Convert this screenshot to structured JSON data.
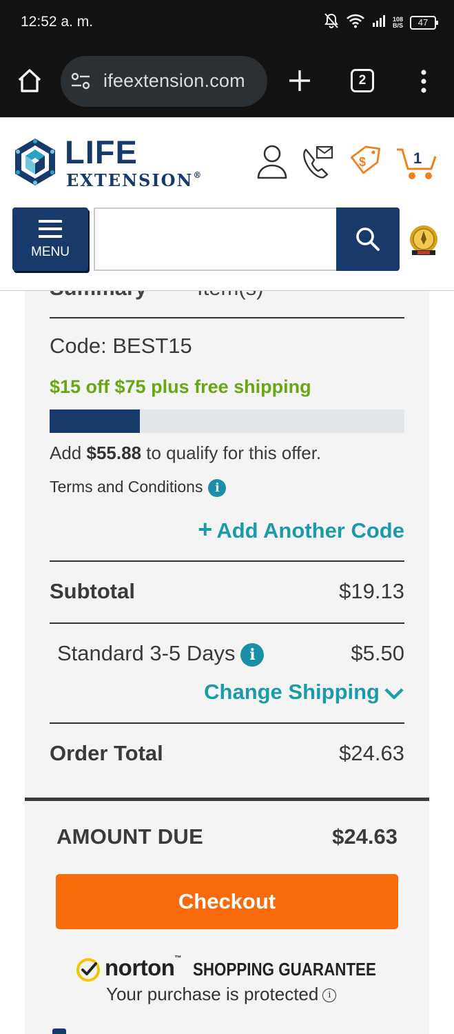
{
  "status_bar": {
    "time": "12:52 a. m.",
    "net_speed_value": "108",
    "net_speed_unit": "B/S",
    "battery": "47"
  },
  "browser": {
    "url": "ifeextension.com",
    "tab_count": "2"
  },
  "header": {
    "logo_line1": "LIFE",
    "logo_line2": "EXTENSION",
    "logo_registered": "®",
    "cart_count": "1",
    "menu_label": "MENU",
    "search_value": "",
    "accent_color": "#173a6b",
    "icons": [
      "account-icon",
      "contact-icon",
      "deals-icon",
      "cart-icon",
      "search-icon",
      "award-badge-icon"
    ]
  },
  "summary": {
    "cut_heading_left": "Summary",
    "cut_heading_right": "Item(s)",
    "code_line": "Code: BEST15",
    "promo_text": "$15 off $75 plus free shipping",
    "progress_fraction": 0.254,
    "qualify_prefix": "Add ",
    "qualify_amount": "$55.88",
    "qualify_suffix": " to qualify for this offer.",
    "terms_label": "Terms and Conditions",
    "add_code_label": "Add Another Code",
    "subtotal_label": "Subtotal",
    "subtotal_value": "$19.13",
    "shipping_label": "Standard 3-5 Days",
    "shipping_value": "$5.50",
    "change_shipping_label": "Change Shipping",
    "order_total_label": "Order Total",
    "order_total_value": "$24.63",
    "amount_due_label": "AMOUNT DUE",
    "amount_due_value": "$24.63",
    "checkout_label": "Checkout",
    "checkout_color": "#f96a0c",
    "link_color": "#1b9aa8",
    "promo_color": "#6aa614"
  },
  "norton": {
    "brand": "norton",
    "guarantee": "SHOPPING GUARANTEE",
    "protected_text": "Your purchase is protected"
  }
}
